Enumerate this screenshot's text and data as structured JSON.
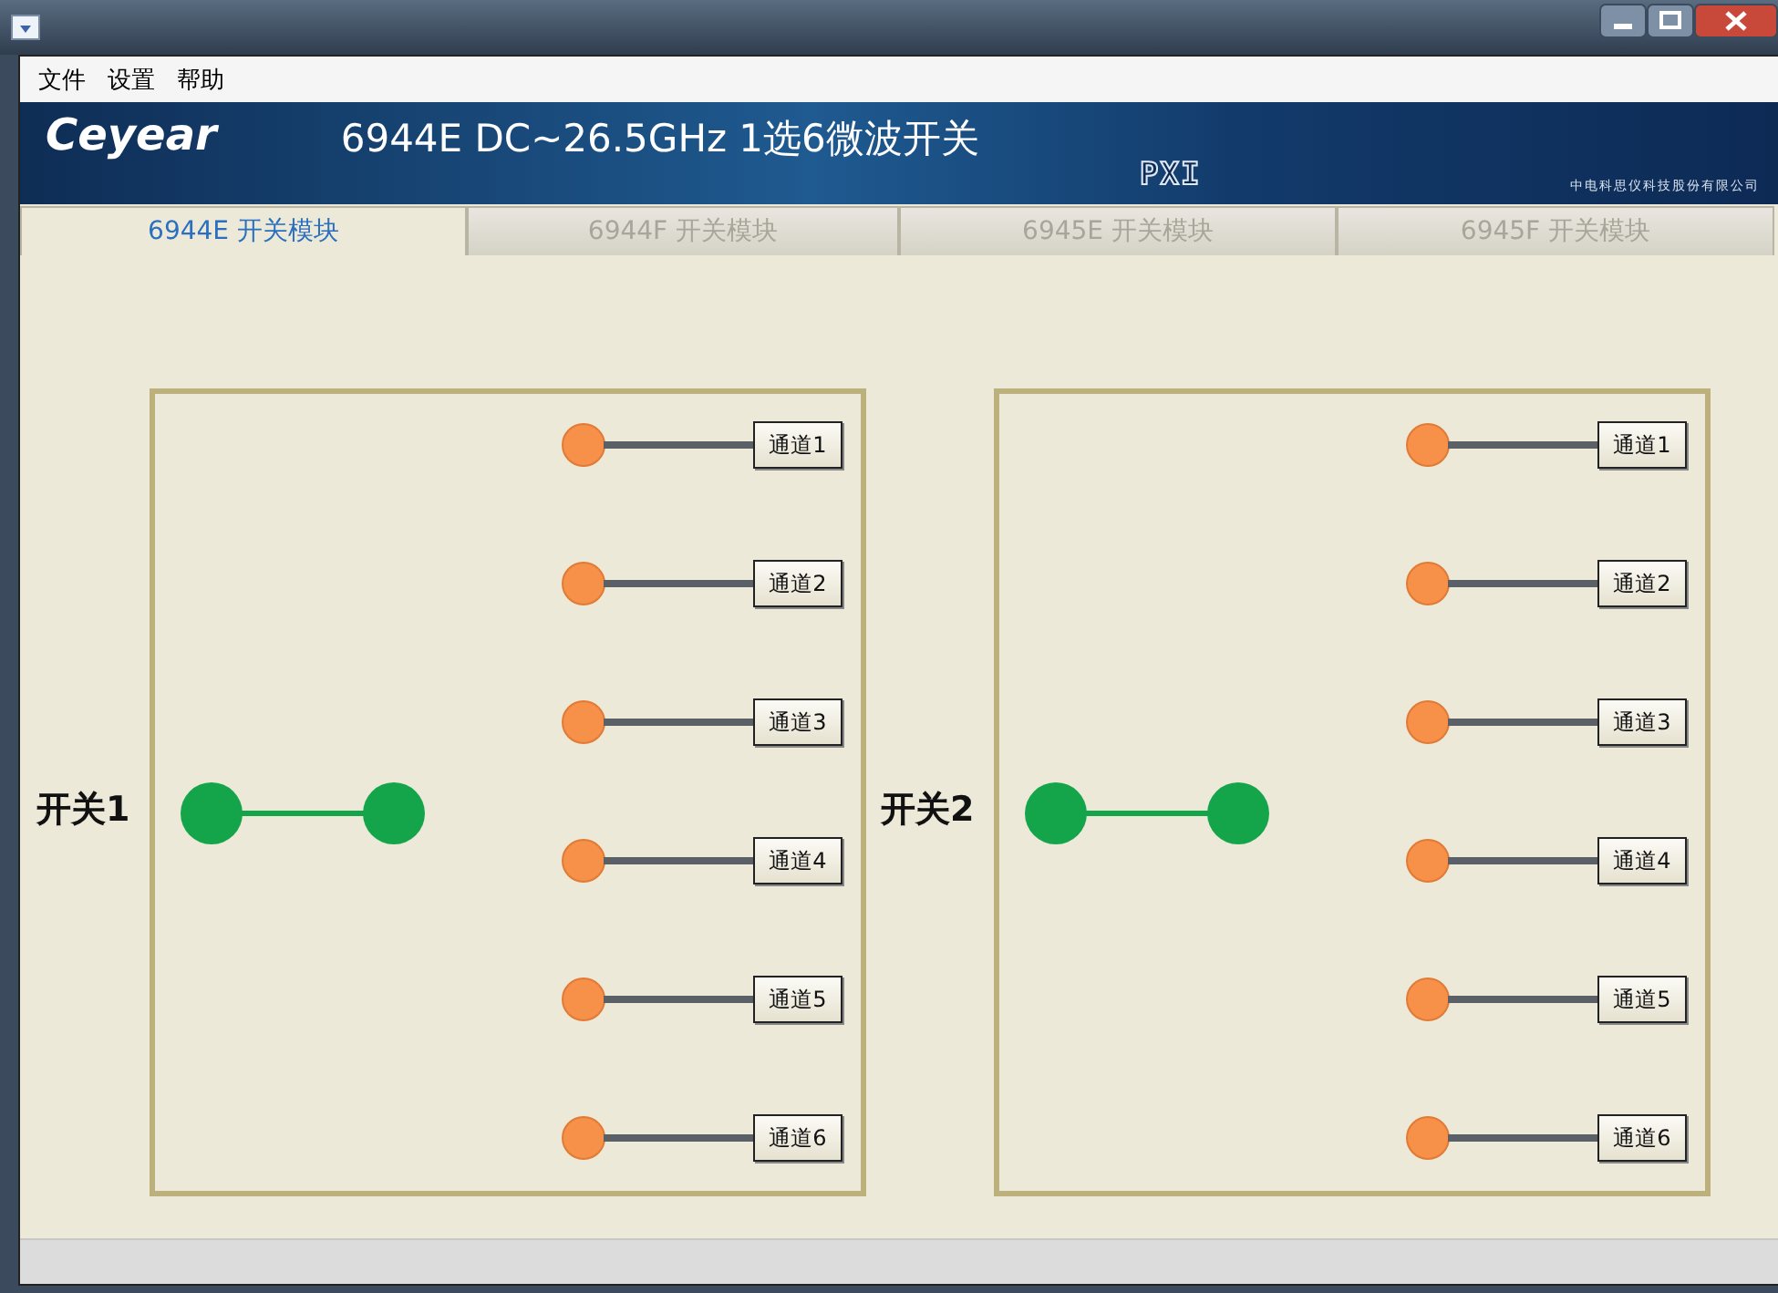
{
  "menu": [
    "文件",
    "设置",
    "帮助"
  ],
  "banner": {
    "logo": "Ceyear",
    "title": "6944E DC~26.5GHz 1选6微波开关",
    "badge": "PXI",
    "company": "中电科思仪科技股份有限公司"
  },
  "tabs": [
    {
      "label": "6944E 开关模块",
      "selected": true
    },
    {
      "label": "6944F 开关模块",
      "selected": false
    },
    {
      "label": "6945E 开关模块",
      "selected": false
    },
    {
      "label": "6945F 开关模块",
      "selected": false
    }
  ],
  "switches": [
    {
      "label": "开关1",
      "channels": [
        "通道1",
        "通道2",
        "通道3",
        "通道4",
        "通道5",
        "通道6"
      ]
    },
    {
      "label": "开关2",
      "channels": [
        "通道1",
        "通道2",
        "通道3",
        "通道4",
        "通道5",
        "通道6"
      ]
    }
  ]
}
